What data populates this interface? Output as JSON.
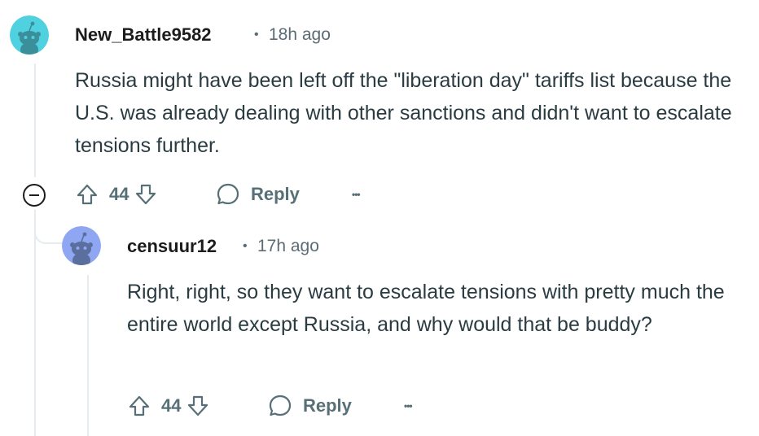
{
  "comments": [
    {
      "username": "New_Battle9582",
      "separator": "•",
      "timestamp": "18h ago",
      "avatar_color": "#4fd1e0",
      "body": "Russia might have been left off the \"liberation day\" tariffs list because the U.S. was already dealing with other sanctions and didn't want to escalate tensions further.",
      "votes": "44",
      "reply_label": "Reply",
      "more_label": "•••"
    },
    {
      "username": "censuur12",
      "separator": "•",
      "timestamp": "17h ago",
      "avatar_color": "#8fa6f2",
      "body": "Right, right, so they want to escalate tensions with pretty much the entire world except Russia, and why would that be buddy?",
      "votes": "44",
      "reply_label": "Reply",
      "more_label": "•••"
    }
  ],
  "icons": {
    "upvote": "upvote-icon",
    "downvote": "downvote-icon",
    "reply": "speech-bubble-icon",
    "more": "more-options-icon",
    "collapse": "collapse-thread-icon"
  },
  "colors": {
    "muted_text": "#5c6c74",
    "body_text": "#2a3c42",
    "thread_line": "#e5ebee"
  }
}
